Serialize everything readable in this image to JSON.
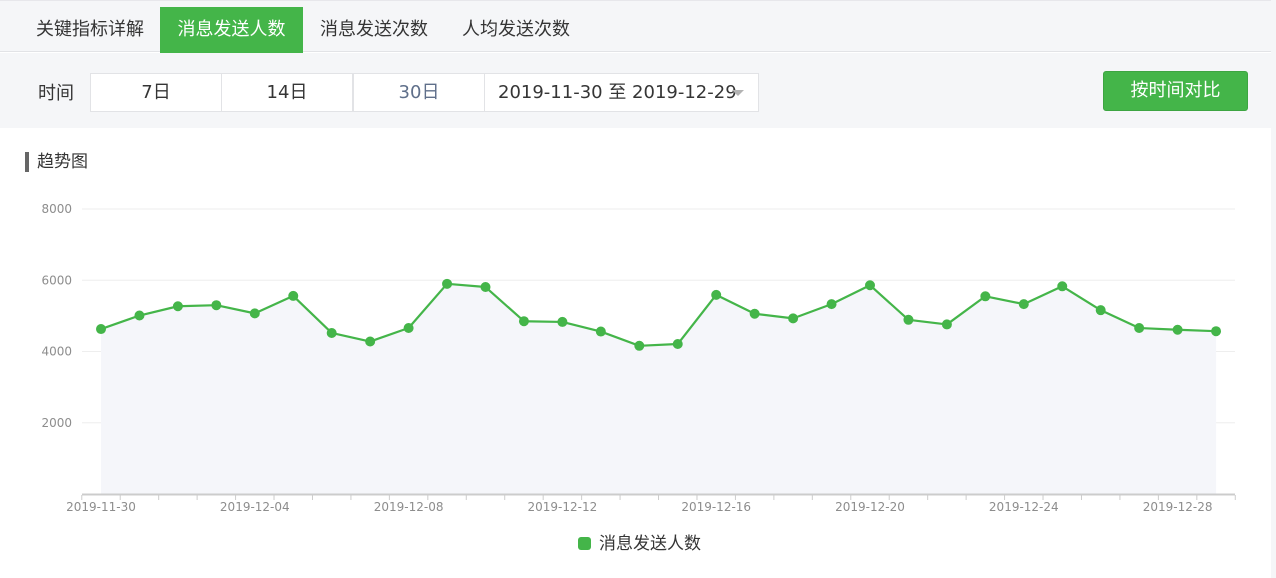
{
  "tabs": [
    {
      "label": "关键指标详解",
      "active": false
    },
    {
      "label": "消息发送人数",
      "active": true
    },
    {
      "label": "消息发送次数",
      "active": false
    },
    {
      "label": "人均发送次数",
      "active": false
    }
  ],
  "filter": {
    "label": "时间",
    "segments": [
      "7日",
      "14日",
      "30日"
    ],
    "selected_segment": "30日",
    "date_range": "2019-11-30 至 2019-12-29",
    "compare_button": "按时间对比"
  },
  "section_title": "趋势图",
  "legend_label": "消息发送人数",
  "colors": {
    "accent": "#44b549",
    "area": "#f5f6fa",
    "grid": "#eeeeee"
  },
  "chart_data": {
    "type": "line",
    "title": "",
    "xlabel": "",
    "ylabel": "",
    "ylim": [
      0,
      8000
    ],
    "y_ticks": [
      "2000",
      "4000",
      "6000",
      "8000"
    ],
    "x": [
      "2019-11-30",
      "2019-12-01",
      "2019-12-02",
      "2019-12-03",
      "2019-12-04",
      "2019-12-05",
      "2019-12-06",
      "2019-12-07",
      "2019-12-08",
      "2019-12-09",
      "2019-12-10",
      "2019-12-11",
      "2019-12-12",
      "2019-12-13",
      "2019-12-14",
      "2019-12-15",
      "2019-12-16",
      "2019-12-17",
      "2019-12-18",
      "2019-12-19",
      "2019-12-20",
      "2019-12-21",
      "2019-12-22",
      "2019-12-23",
      "2019-12-24",
      "2019-12-25",
      "2019-12-26",
      "2019-12-27",
      "2019-12-28",
      "2019-12-29"
    ],
    "x_tick_labels": [
      "2019-11-30",
      "2019-12-04",
      "2019-12-08",
      "2019-12-12",
      "2019-12-16",
      "2019-12-20",
      "2019-12-24",
      "2019-12-28"
    ],
    "series": [
      {
        "name": "消息发送人数",
        "values": [
          4630,
          5010,
          5270,
          5300,
          5070,
          5560,
          4520,
          4280,
          4660,
          5900,
          5810,
          4850,
          4830,
          4560,
          4160,
          4210,
          5590,
          5060,
          4930,
          5330,
          5860,
          4890,
          4760,
          5550,
          5330,
          5830,
          5160,
          4660,
          4610,
          4570
        ]
      }
    ],
    "grid": true,
    "legend_position": "bottom-center"
  }
}
